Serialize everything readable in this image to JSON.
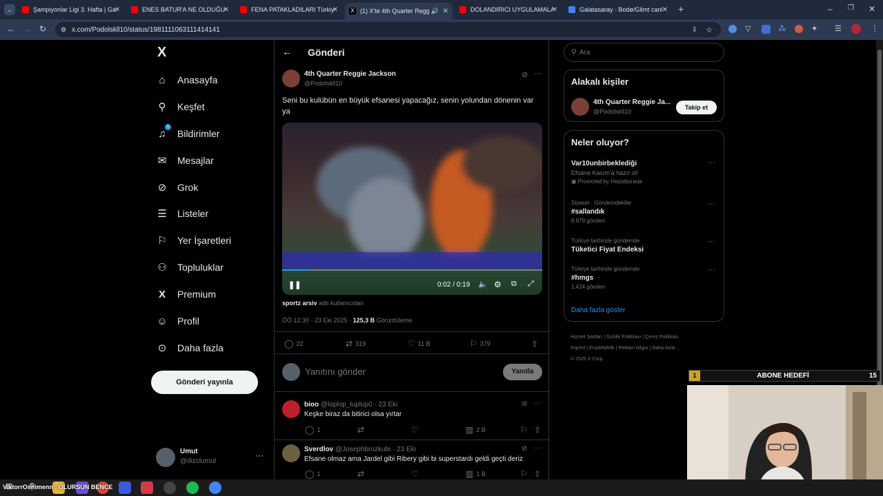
{
  "browser": {
    "tabs": [
      {
        "title": "Şampiyonlar Ligi 3. Hafta | Gala",
        "favicon_color": "#ff0000"
      },
      {
        "title": "ENES BATUR'A NE OLDUĞUNU",
        "favicon_color": "#ff0000"
      },
      {
        "title": "FENA PATAKLADILARI Türkiye'",
        "favicon_color": "#ff0000"
      },
      {
        "title": "(1) X'te 4th Quarter Reggie",
        "favicon_color": "#000000"
      },
      {
        "title": "DOLANDIRICI UYGULAMALAR",
        "favicon_color": "#ff0000"
      },
      {
        "title": "Galatasaray - Bodø/Glimt canlı",
        "favicon_color": "#4285f4"
      }
    ],
    "url": "x.com/Podolskll10/status/1981111063111414141"
  },
  "sidebar": {
    "logo": "X",
    "items": [
      {
        "label": "Anasayfa",
        "icon": "home-icon"
      },
      {
        "label": "Keşfet",
        "icon": "search-icon"
      },
      {
        "label": "Bildirimler",
        "icon": "bell-icon",
        "badge": "1"
      },
      {
        "label": "Mesajlar",
        "icon": "mail-icon"
      },
      {
        "label": "Grok",
        "icon": "grok-icon"
      },
      {
        "label": "Listeler",
        "icon": "list-icon"
      },
      {
        "label": "Yer İşaretleri",
        "icon": "bookmark-icon"
      },
      {
        "label": "Topluluklar",
        "icon": "people-icon"
      },
      {
        "label": "Premium",
        "icon": "x-premium-icon"
      },
      {
        "label": "Profil",
        "icon": "person-icon"
      },
      {
        "label": "Daha fazla",
        "icon": "more-circle-icon"
      }
    ],
    "post_button": "Gönderi yayınla",
    "account": {
      "name": "Umut",
      "handle": "@dizclumut"
    }
  },
  "main": {
    "header": "Gönderi",
    "post": {
      "author": "4th Quarter Reggie Jackson",
      "handle": "@Podolskll10",
      "text": "Seni bu kulübün en büyük efsanesi yapacağız, senin yolundan dönenin var ya",
      "video_time": "0:02 / 0:19",
      "video_progress": 0.105,
      "source_user": "sportz arsiv",
      "source_suffix": "adlı kullanıcıdan",
      "timestamp": "ÖÖ 12:30 · 23 Eki 2025 ·",
      "views": "125,3 B",
      "views_label": "Görüntüleme",
      "stats": {
        "replies": "22",
        "reposts": "319",
        "likes": "11 B",
        "bookmarks": "379"
      }
    },
    "reply_placeholder": "Yanıtını gönder",
    "reply_button": "Yanıtla",
    "replies": [
      {
        "name": "bioo",
        "meta": "@loplop_luplup0 · 23 Eki",
        "text": "Keşke biraz da bitirici olsa yırtar",
        "replies": "1",
        "views": "2 B"
      },
      {
        "name": "Sverdlov",
        "meta": "@Josephbrozkubi · 23 Eki",
        "text": "Efsane olmaz ama Jardel gibi Ribery gibi bi superstardı geldi geçti deriz",
        "replies": "1",
        "views": "1 B"
      }
    ]
  },
  "right": {
    "search_placeholder": "Ara",
    "related_title": "Alakalı kişiler",
    "related_person": {
      "name": "4th Quarter Reggie Ja...",
      "handle": "@Podolskll10",
      "follow": "Takip et"
    },
    "trends_title": "Neler oluyor?",
    "trends": [
      {
        "category": "",
        "name": "Var10unbirbeklediği",
        "sub": "Efsane Kasım'a hazır ol!",
        "count": "Promoted by Hepsiburada"
      },
      {
        "category": "Siyaset · Gündemdekiler",
        "name": "#sallandık",
        "sub": "",
        "count": "8.979 gönderi"
      },
      {
        "category": "Türkiye tarihinde gündemde",
        "name": "Tüketici Fiyat Endeksi",
        "sub": "",
        "count": ""
      },
      {
        "category": "Türkiye tarihinde gündemde",
        "name": "#hmgs",
        "sub": "",
        "count": "1.424 gönderi"
      }
    ],
    "show_more": "Daha fazla göster",
    "footer_line1": [
      "Hizmet Şartları",
      "Gizlilik Politikası",
      "Çerez Politikası"
    ],
    "footer_line2": [
      "Imprint",
      "Erişilebilirlik",
      "Reklam bilgisi",
      "Daha fazla ..."
    ],
    "copyright": "© 2025 X Corp."
  },
  "overlay": {
    "goal_label": "ABONE HEDEFİ",
    "goal_left": "1",
    "goal_right": "15",
    "taskbar_ticker": "ViktorrOshimenn : OLURSUN BENCE"
  },
  "colors": {
    "accent": "#1d9bf0",
    "bg": "#000000",
    "border": "#2f3336",
    "muted": "#71767b"
  }
}
